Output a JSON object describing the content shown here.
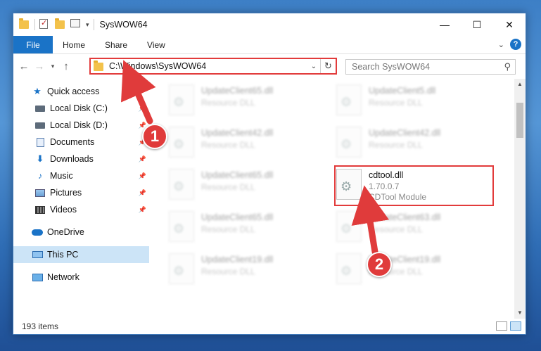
{
  "window": {
    "title": "SysWOW64",
    "controls": {
      "minimize": "—",
      "maximize": "☐",
      "close": "✕"
    }
  },
  "ribbon": {
    "tabs": [
      "File",
      "Home",
      "Share",
      "View"
    ],
    "help": "?"
  },
  "address": {
    "path": "C:\\Windows\\SysWOW64",
    "search_placeholder": "Search SysWOW64"
  },
  "sidebar": {
    "items": [
      {
        "label": "Quick access",
        "icon": "star-icon"
      },
      {
        "label": "Local Disk (C:)",
        "icon": "drive-icon",
        "pinned": true
      },
      {
        "label": "Local Disk (D:)",
        "icon": "drive-icon",
        "pinned": true
      },
      {
        "label": "Documents",
        "icon": "documents-icon",
        "pinned": true
      },
      {
        "label": "Downloads",
        "icon": "downloads-icon",
        "pinned": true
      },
      {
        "label": "Music",
        "icon": "music-icon",
        "pinned": true
      },
      {
        "label": "Pictures",
        "icon": "pictures-icon",
        "pinned": true
      },
      {
        "label": "Videos",
        "icon": "videos-icon",
        "pinned": true
      },
      {
        "label": "OneDrive",
        "icon": "onedrive-icon"
      },
      {
        "label": "This PC",
        "icon": "this-pc-icon",
        "selected": true
      },
      {
        "label": "Network",
        "icon": "network-icon"
      }
    ]
  },
  "files": [
    {
      "name": "UpdateClient65.dll",
      "sub1": "Resource DLL",
      "sub2": ""
    },
    {
      "name": "UpdateClient5.dll",
      "sub1": "Resource DLL",
      "sub2": ""
    },
    {
      "name": "UpdateClient42.dll",
      "sub1": "Resource DLL",
      "sub2": ""
    },
    {
      "name": "UpdateClient42.dll",
      "sub1": "Resource DLL",
      "sub2": ""
    },
    {
      "name": "UpdateClient65.dll",
      "sub1": "Resource DLL",
      "sub2": ""
    },
    {
      "name": "cdtool.dll",
      "sub1": "1.70.0.7",
      "sub2": "CDTool Module"
    },
    {
      "name": "UpdateClient65.dll",
      "sub1": "Resource DLL",
      "sub2": ""
    },
    {
      "name": "UpdateClient63.dll",
      "sub1": "Resource DLL",
      "sub2": ""
    },
    {
      "name": "UpdateClient19.dll",
      "sub1": "Resource DLL",
      "sub2": ""
    },
    {
      "name": "UpdateClient19.dll",
      "sub1": "Resource DLL",
      "sub2": ""
    }
  ],
  "status": {
    "count": "193 items"
  },
  "callouts": {
    "one": "1",
    "two": "2"
  },
  "colors": {
    "accent": "#1a73c7",
    "highlight": "#e23b3b",
    "selected": "#cce4f7"
  }
}
